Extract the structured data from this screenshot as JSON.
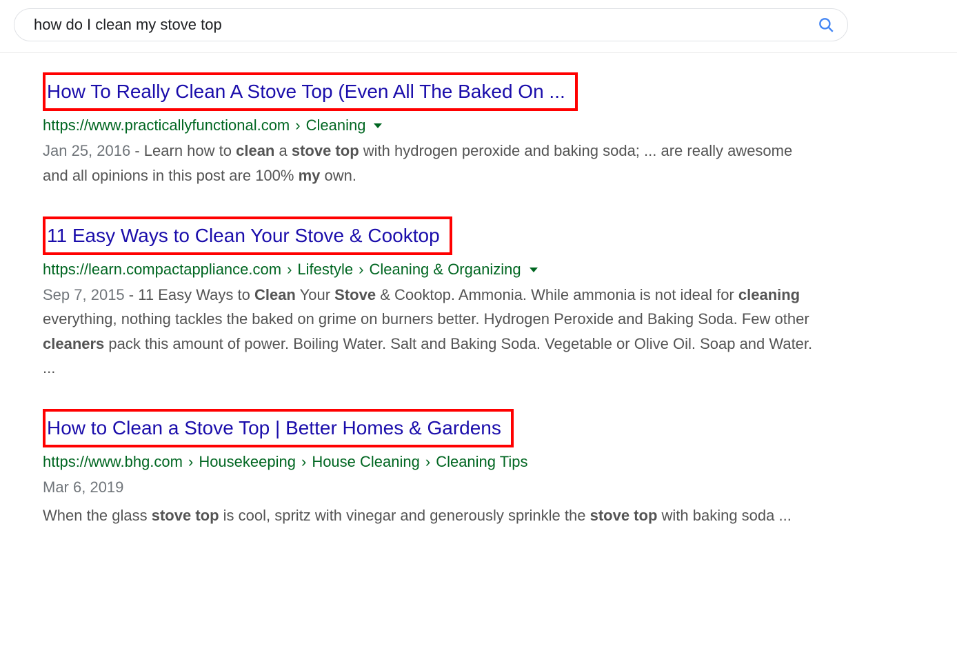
{
  "search": {
    "query": "how do I clean my stove top"
  },
  "results": [
    {
      "title": "How To Really Clean A Stove Top (Even All The Baked On ...",
      "url_base": "https://www.practicallyfunctional.com",
      "crumbs": [
        "Cleaning"
      ],
      "has_dropdown": true,
      "date": "Jan 25, 2016",
      "snippet_parts": [
        {
          "t": " - Learn how to ",
          "b": false
        },
        {
          "t": "clean",
          "b": true
        },
        {
          "t": " a ",
          "b": false
        },
        {
          "t": "stove top",
          "b": true
        },
        {
          "t": " with hydrogen peroxide and baking soda; ... are really awesome and all opinions in this post are 100% ",
          "b": false
        },
        {
          "t": "my",
          "b": true
        },
        {
          "t": " own.",
          "b": false
        }
      ]
    },
    {
      "title": "11 Easy Ways to Clean Your Stove & Cooktop",
      "url_base": "https://learn.compactappliance.com",
      "crumbs": [
        "Lifestyle",
        "Cleaning & Organizing"
      ],
      "has_dropdown": true,
      "date": "Sep 7, 2015",
      "snippet_parts": [
        {
          "t": " - 11 Easy Ways to ",
          "b": false
        },
        {
          "t": "Clean",
          "b": true
        },
        {
          "t": " Your ",
          "b": false
        },
        {
          "t": "Stove",
          "b": true
        },
        {
          "t": " & Cooktop. Ammonia. While ammonia is not ideal for ",
          "b": false
        },
        {
          "t": "cleaning",
          "b": true
        },
        {
          "t": " everything, nothing tackles the baked on grime on burners better. Hydrogen Peroxide and Baking Soda. Few other ",
          "b": false
        },
        {
          "t": "cleaners",
          "b": true
        },
        {
          "t": " pack this amount of power. Boiling Water. Salt and Baking Soda. Vegetable or Olive Oil. Soap and Water. ...",
          "b": false
        }
      ]
    },
    {
      "title": "How to Clean a Stove Top | Better Homes & Gardens",
      "url_base": "https://www.bhg.com",
      "crumbs": [
        "Housekeeping",
        "House Cleaning",
        "Cleaning Tips"
      ],
      "has_dropdown": false,
      "date": "Mar 6, 2019",
      "date_own_line": true,
      "snippet_parts": [
        {
          "t": "When the glass ",
          "b": false
        },
        {
          "t": "stove top",
          "b": true
        },
        {
          "t": " is cool, spritz with vinegar and generously sprinkle the ",
          "b": false
        },
        {
          "t": "stove top",
          "b": true
        },
        {
          "t": " with baking soda ...",
          "b": false
        }
      ]
    }
  ]
}
